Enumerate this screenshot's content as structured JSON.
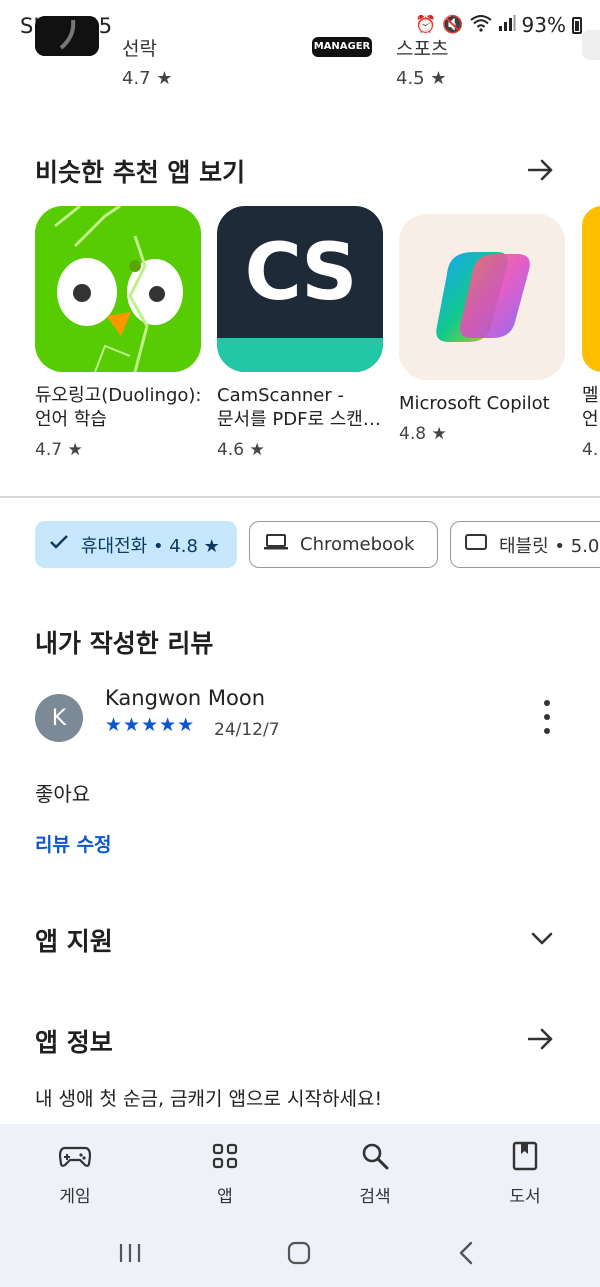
{
  "status_bar": {
    "time": "SKT 8:45",
    "battery": "93%"
  },
  "previous_row": {
    "items": [
      {
        "name": "선락",
        "rating": "4.7 ★"
      },
      {
        "name": "스포츠",
        "rating": "4.5 ★",
        "badge": "MANAGER"
      }
    ]
  },
  "similar_apps": {
    "title": "비슷한 추천 앱 보기",
    "apps": [
      {
        "name_line1": "듀오링고(Duolingo):",
        "name_line2": "언어 학습",
        "rating": "4.7 ★",
        "icon": "duolingo-icon"
      },
      {
        "name_line1": "CamScanner -",
        "name_line2": "문서를 PDF로 스캔…",
        "rating": "4.6 ★",
        "icon": "camscanner-icon",
        "icon_text": "CS"
      },
      {
        "name_line1": "Microsoft Copilot",
        "name_line2": "",
        "rating": "4.8 ★",
        "icon": "copilot-icon"
      },
      {
        "name_line1": "멜",
        "name_line2": "언",
        "rating": "4.",
        "icon": "partial-app-icon"
      }
    ]
  },
  "device_chips": [
    {
      "label": "휴대전화 • 4.8 ★",
      "icon": "check-icon",
      "selected": true
    },
    {
      "label": "Chromebook",
      "icon": "laptop-icon",
      "selected": false
    },
    {
      "label": "태블릿 • 5.0",
      "icon": "tablet-icon",
      "selected": false
    }
  ],
  "my_review": {
    "title": "내가 작성한 리뷰",
    "avatar_letter": "K",
    "author": "Kangwon Moon",
    "stars": "★★★★★",
    "rating": 5,
    "date": "24/12/7",
    "text": "좋아요",
    "edit_label": "리뷰 수정"
  },
  "app_support": {
    "title": "앱 지원"
  },
  "app_info": {
    "title": "앱 정보",
    "description": "내 생애 첫 순금, 금캐기 앱으로 시작하세요!"
  },
  "bottom_nav": {
    "items": [
      {
        "label": "게임",
        "icon": "gamepad-icon"
      },
      {
        "label": "앱",
        "icon": "apps-grid-icon"
      },
      {
        "label": "검색",
        "icon": "search-icon"
      },
      {
        "label": "도서",
        "icon": "book-icon"
      }
    ]
  },
  "colors": {
    "accent": "#0b57d0",
    "chip_selected_bg": "#c6e7fc",
    "nav_bg": "#eef1f7"
  }
}
